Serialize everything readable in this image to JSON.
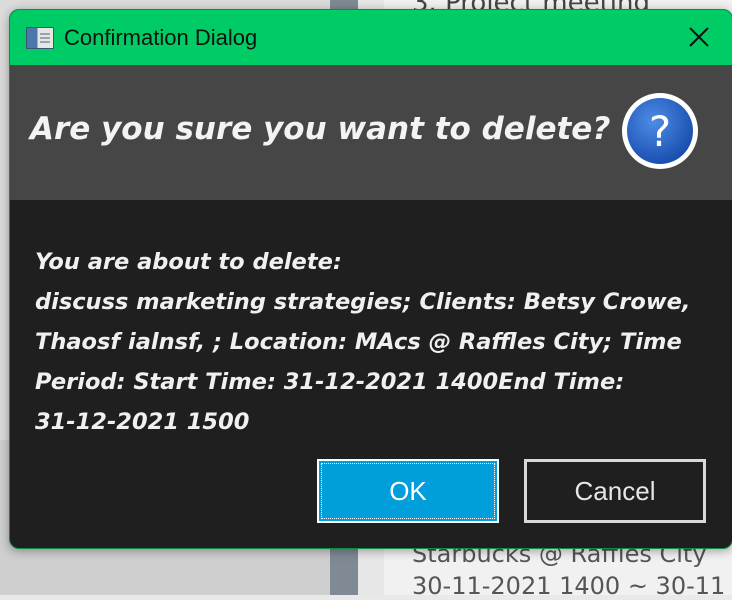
{
  "background": {
    "heading_fragment": "3. Project meeting",
    "location_fragment": "Starbucks @ Raffles City",
    "time_fragment": "30-11-2021 1400  ~  30-11"
  },
  "dialog": {
    "title": "Confirmation Dialog",
    "close_label": "✕",
    "header": "Are you sure you want to delete?",
    "help_icon": "question-mark-icon",
    "body_lines": [
      "You are about to delete:",
      "discuss marketing strategies; Clients: Betsy Crowe,",
      "Thaosf ialnsf, ; Location: MAcs @ Raffles City; Time",
      "Period: Start Time: 31-12-2021 1400End Time:",
      "31-12-2021 1500"
    ],
    "ok_label": "OK",
    "cancel_label": "Cancel"
  },
  "colors": {
    "titlebar": "#00cc66",
    "header_bg": "#464646",
    "body_bg": "#1f1f1f",
    "ok_bg": "#009fdb",
    "help_icon_blue": "#1e5bbf"
  }
}
